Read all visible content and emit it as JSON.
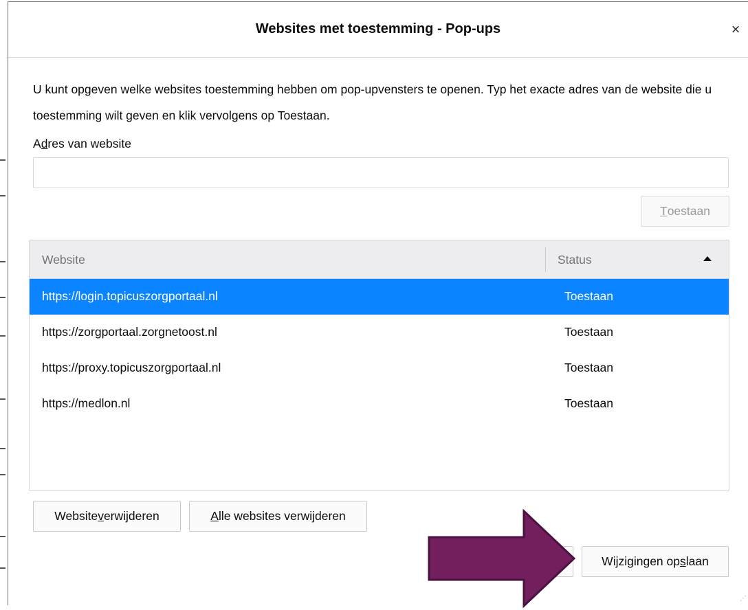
{
  "dialog": {
    "title": "Websites met toestemming - Pop-ups",
    "close_symbol": "×",
    "description": "U kunt opgeven welke websites toestemming hebben om pop-upvensters te openen. Typ het exacte adres van de website die u toestemming wilt geven en klik vervolgens op Toestaan.",
    "address_label": {
      "before": "A",
      "accesskey": "d",
      "after": "res van website"
    },
    "address_input": {
      "value": "",
      "placeholder": ""
    },
    "allow_button": {
      "before": "",
      "accesskey": "T",
      "after": "oestaan",
      "disabled": true
    },
    "table": {
      "columns": [
        "Website",
        "Status"
      ],
      "sort_icon": "triangle-up-icon",
      "rows": [
        {
          "site": "https://login.topicuszorgportaal.nl",
          "status": "Toestaan",
          "selected": true
        },
        {
          "site": "https://zorgportaal.zorgnetoost.nl",
          "status": "Toestaan",
          "selected": false
        },
        {
          "site": "https://proxy.topicuszorgportaal.nl",
          "status": "Toestaan",
          "selected": false
        },
        {
          "site": "https://medlon.nl",
          "status": "Toestaan",
          "selected": false
        }
      ]
    },
    "remove_button": {
      "before": "Website ",
      "accesskey": "v",
      "after": "erwijderen"
    },
    "remove_all_button": {
      "before": "",
      "accesskey": "A",
      "after": "lle websites verwijderen"
    },
    "save_button": {
      "before": "Wijzigingen op",
      "accesskey": "s",
      "after": "laan"
    }
  },
  "colors": {
    "selected_row": "#0a84ff",
    "arrow_fill": "#731f5e",
    "arrow_stroke": "#4a1240"
  }
}
